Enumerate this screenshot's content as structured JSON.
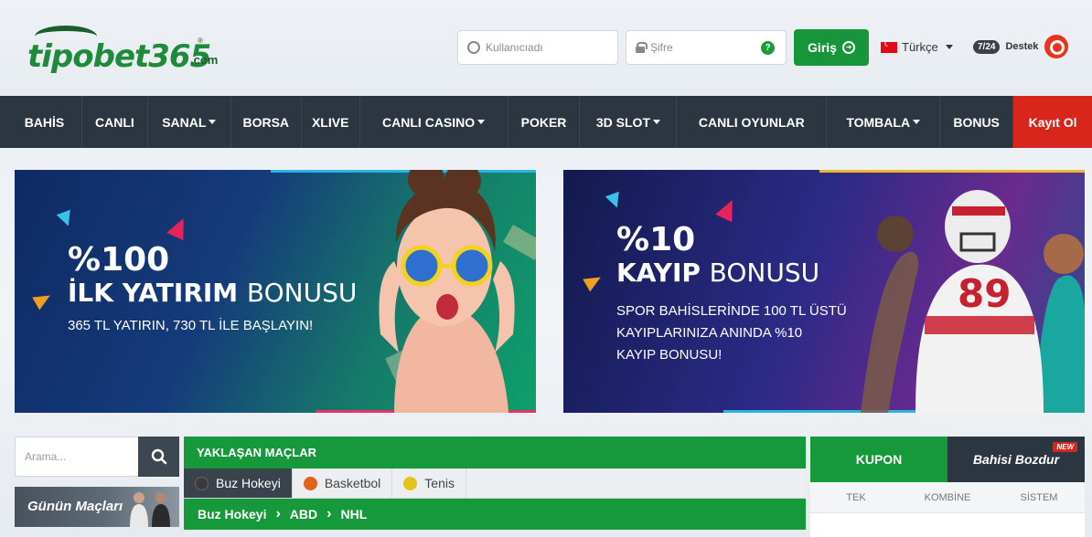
{
  "header": {
    "logo_text": "tipobet365",
    "logo_suffix": ".com",
    "logo_reg": "®",
    "username_placeholder": "Kullanıcıadı",
    "password_placeholder": "Şifre",
    "help_glyph": "?",
    "login_label": "Giriş",
    "language": "Türkçe",
    "support_badge": "7/24",
    "support_label": "Destek"
  },
  "nav": {
    "items": [
      {
        "label": "BAHİS",
        "dropdown": false
      },
      {
        "label": "CANLI",
        "dropdown": false
      },
      {
        "label": "SANAL",
        "dropdown": true
      },
      {
        "label": "BORSA",
        "dropdown": false
      },
      {
        "label": "XLIVE",
        "dropdown": false
      },
      {
        "label": "CANLI CASINO",
        "dropdown": true
      },
      {
        "label": "POKER",
        "dropdown": false
      },
      {
        "label": "3D SLOT",
        "dropdown": true
      },
      {
        "label": "CANLI OYUNLAR",
        "dropdown": false
      },
      {
        "label": "TOMBALA",
        "dropdown": true
      },
      {
        "label": "BONUS",
        "dropdown": false
      }
    ],
    "register_label": "Kayıt Ol"
  },
  "banners": {
    "first": {
      "percent": "%100",
      "title_bold": "İLK YATIRIM",
      "title_light": "BONUSU",
      "subtitle": "365 TL YATIRIN, 730 TL İLE BAŞLAYIN!"
    },
    "second": {
      "percent": "%10",
      "title_bold": "KAYIP",
      "title_light": "BONUSU",
      "line1": "SPOR BAHİSLERİNDE 100 TL ÜSTÜ",
      "line2": "KAYIPLARINIZA ANINDA %10",
      "line3": "KAYIP BONUSU!",
      "jersey_number": "89"
    }
  },
  "sidebar": {
    "search_placeholder": "Arama...",
    "featured_label": "Günün Maçları"
  },
  "matches": {
    "title": "YAKLAŞAN MAÇLAR",
    "tabs": [
      {
        "label": "Buz Hokeyi",
        "active": true,
        "ball_color": "#3a3a3a"
      },
      {
        "label": "Basketbol",
        "active": false,
        "ball_color": "#e0621d"
      },
      {
        "label": "Tenis",
        "active": false,
        "ball_color": "#e3c51a"
      }
    ],
    "breadcrumb": [
      "Buz Hokeyi",
      "ABD",
      "NHL"
    ]
  },
  "coupon": {
    "tab_coupon": "KUPON",
    "tab_cashout": "Bahisi Bozdur",
    "new_badge": "NEW",
    "types": [
      "TEK",
      "KOMBİNE",
      "SİSTEM"
    ]
  },
  "colors": {
    "brand_green": "#16993b",
    "nav_dark": "#2b3640",
    "register_red": "#d9261c"
  }
}
